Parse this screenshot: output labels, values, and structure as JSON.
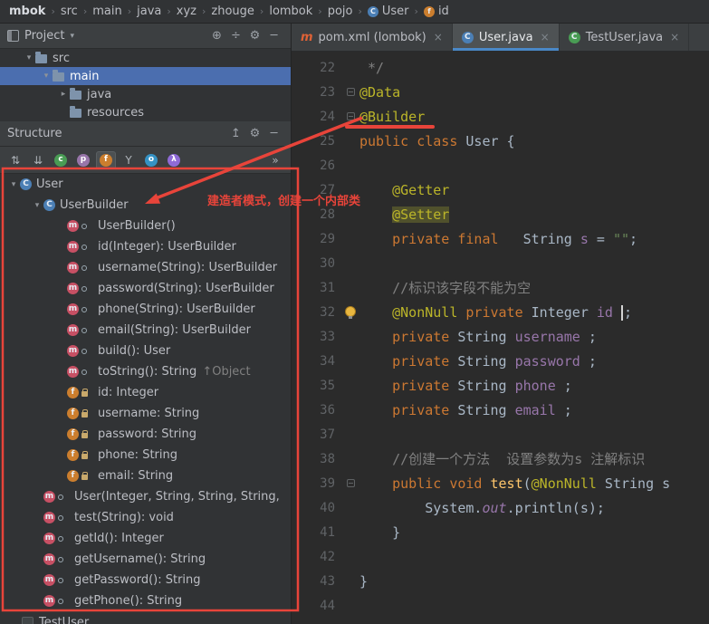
{
  "colors": {
    "annotation_red": "#e8443a",
    "active_tab_underline": "#4a88c7",
    "selection_blue": "#4b6eaf",
    "editor_background": "#2b2b2b"
  },
  "breadcrumbs": {
    "separator": "›",
    "items": [
      {
        "label": "mbok",
        "bold": true
      },
      {
        "label": "src"
      },
      {
        "label": "main"
      },
      {
        "label": "java"
      },
      {
        "label": "xyz"
      },
      {
        "label": "zhouge"
      },
      {
        "label": "lombok"
      },
      {
        "label": "pojo"
      },
      {
        "label": "User",
        "icon": "class"
      },
      {
        "label": "id",
        "icon": "field"
      }
    ]
  },
  "project": {
    "title": "Project",
    "header_icons": [
      {
        "name": "locate-button",
        "glyph": "⊕"
      },
      {
        "name": "collapse-all-button",
        "glyph": "÷"
      },
      {
        "name": "settings-button",
        "glyph": "⚙"
      },
      {
        "name": "hide-panel-button",
        "glyph": "─"
      }
    ],
    "rows": [
      {
        "label": "src",
        "level": 1,
        "chevron": "down"
      },
      {
        "label": "main",
        "level": 2,
        "chevron": "down",
        "selected": true
      },
      {
        "label": "java",
        "level": 3,
        "chevron": "right"
      },
      {
        "label": "resources",
        "level": 3,
        "chevron": "none"
      }
    ]
  },
  "structure": {
    "title": "Structure",
    "header_icons": [
      {
        "name": "scroll-to-source-button",
        "glyph": "↥"
      },
      {
        "name": "settings-button",
        "glyph": "⚙"
      },
      {
        "name": "hide-panel-button",
        "glyph": "─"
      }
    ],
    "toolbar": [
      {
        "name": "sort-alpha-button",
        "glyph": "⇅"
      },
      {
        "name": "sort-visibility-button",
        "glyph": "⇊"
      },
      {
        "name": "show-classes-toggle",
        "letter": "c",
        "color": "#499c54"
      },
      {
        "name": "show-properties-toggle",
        "letter": "p",
        "color": "#9876aa"
      },
      {
        "name": "show-fields-toggle",
        "letter": "f",
        "color": "#cb7e2e",
        "active": true
      },
      {
        "name": "filter-toggle",
        "glyph": "Y"
      },
      {
        "name": "show-objects-toggle",
        "letter": "o",
        "color": "#3592c4"
      },
      {
        "name": "show-lambdas-toggle",
        "letter": "λ",
        "color": "#8f6bd6"
      },
      {
        "name": "more-actions-button",
        "glyph": "»",
        "right": true
      }
    ],
    "rows": [
      {
        "label": "User",
        "icon": "class",
        "level": 0,
        "chevron": "down"
      },
      {
        "label": "UserBuilder",
        "icon": "class",
        "level": 1,
        "chevron": "down"
      },
      {
        "label": "UserBuilder()",
        "icon": "method",
        "emblem": "pub",
        "level": 2
      },
      {
        "label": "id(Integer): UserBuilder",
        "icon": "method",
        "emblem": "pub",
        "level": 2
      },
      {
        "label": "username(String): UserBuilder",
        "icon": "method",
        "emblem": "pub",
        "level": 2
      },
      {
        "label": "password(String): UserBuilder",
        "icon": "method",
        "emblem": "pub",
        "level": 2
      },
      {
        "label": "phone(String): UserBuilder",
        "icon": "method",
        "emblem": "pub",
        "level": 2
      },
      {
        "label": "email(String): UserBuilder",
        "icon": "method",
        "emblem": "pub",
        "level": 2
      },
      {
        "label": "build(): User",
        "icon": "method",
        "emblem": "pub",
        "level": 2
      },
      {
        "label": "toString(): String",
        "suffix": "↑Object",
        "icon": "method",
        "emblem": "pub",
        "level": 2
      },
      {
        "label": "id: Integer",
        "icon": "field",
        "emblem": "lock",
        "level": 2
      },
      {
        "label": "username: String",
        "icon": "field",
        "emblem": "lock",
        "level": 2
      },
      {
        "label": "password: String",
        "icon": "field",
        "emblem": "lock",
        "level": 2
      },
      {
        "label": "phone: String",
        "icon": "field",
        "emblem": "lock",
        "level": 2
      },
      {
        "label": "email: String",
        "icon": "field",
        "emblem": "lock",
        "level": 2
      },
      {
        "label": "User(Integer, String, String, String,",
        "icon": "method",
        "emblem": "pub",
        "level": 1
      },
      {
        "label": "test(String): void",
        "icon": "method",
        "emblem": "pub",
        "level": 1
      },
      {
        "label": "getId(): Integer",
        "icon": "method",
        "emblem": "pub",
        "level": 1
      },
      {
        "label": "getUsername(): String",
        "icon": "method",
        "emblem": "pub",
        "level": 1
      },
      {
        "label": "getPassword(): String",
        "icon": "method",
        "emblem": "pub",
        "level": 1
      },
      {
        "label": "getPhone(): String",
        "icon": "method",
        "emblem": "pub",
        "level": 1
      }
    ],
    "partial_bottom_label": "TestUser"
  },
  "editor": {
    "tabs": [
      {
        "label": "pom.xml (lombok)",
        "icon": "maven"
      },
      {
        "label": "User.java",
        "icon": "class",
        "active": true
      },
      {
        "label": "TestUser.java",
        "icon": "testclass"
      }
    ],
    "close_glyph": "×",
    "lines": [
      {
        "num": 22,
        "tokens": [
          [
            " */",
            "cmt"
          ]
        ]
      },
      {
        "num": 23,
        "fold": true,
        "tokens": [
          [
            "@Data",
            "ann"
          ]
        ]
      },
      {
        "num": 24,
        "fold": true,
        "tokens": [
          [
            "@Builder",
            "ann"
          ]
        ]
      },
      {
        "num": 25,
        "tokens": [
          [
            "public class",
            "kw"
          ],
          [
            " User {",
            "pln"
          ]
        ]
      },
      {
        "num": 26,
        "tokens": []
      },
      {
        "num": 27,
        "tokens": [
          [
            "    ",
            "pln"
          ],
          [
            "@Getter",
            "ann"
          ]
        ]
      },
      {
        "num": 28,
        "tokens": [
          [
            "    ",
            "pln"
          ],
          [
            "@Setter",
            "annhl"
          ]
        ]
      },
      {
        "num": 29,
        "tokens": [
          [
            "    ",
            "pln"
          ],
          [
            "private final",
            "kw"
          ],
          [
            "   String ",
            "pln"
          ],
          [
            "s",
            "fld"
          ],
          [
            " = ",
            "pln"
          ],
          [
            "\"\"",
            "str"
          ],
          [
            ";",
            "pln"
          ]
        ]
      },
      {
        "num": 30,
        "tokens": []
      },
      {
        "num": 31,
        "tokens": [
          [
            "    ",
            "pln"
          ],
          [
            "//标识该字段不能为空",
            "cmt"
          ]
        ]
      },
      {
        "num": 32,
        "bulb": true,
        "tokens": [
          [
            "    ",
            "pln"
          ],
          [
            "@NonNull",
            "ann"
          ],
          [
            " ",
            "pln"
          ],
          [
            "private",
            "kw"
          ],
          [
            " ",
            "pln"
          ],
          [
            "Integer ",
            "pln"
          ],
          [
            "id",
            "fld"
          ],
          [
            " ",
            "pln"
          ],
          [
            "",
            "caret"
          ],
          [
            ";",
            "pln"
          ]
        ]
      },
      {
        "num": 33,
        "tokens": [
          [
            "    ",
            "pln"
          ],
          [
            "private",
            "kw"
          ],
          [
            " String ",
            "pln"
          ],
          [
            "username",
            "fld"
          ],
          [
            " ;",
            "pln"
          ]
        ]
      },
      {
        "num": 34,
        "tokens": [
          [
            "    ",
            "pln"
          ],
          [
            "private",
            "kw"
          ],
          [
            " String ",
            "pln"
          ],
          [
            "password",
            "fld"
          ],
          [
            " ;",
            "pln"
          ]
        ]
      },
      {
        "num": 35,
        "tokens": [
          [
            "    ",
            "pln"
          ],
          [
            "private",
            "kw"
          ],
          [
            " String ",
            "pln"
          ],
          [
            "phone",
            "fld"
          ],
          [
            " ;",
            "pln"
          ]
        ]
      },
      {
        "num": 36,
        "tokens": [
          [
            "    ",
            "pln"
          ],
          [
            "private",
            "kw"
          ],
          [
            " String ",
            "pln"
          ],
          [
            "email",
            "fld"
          ],
          [
            " ;",
            "pln"
          ]
        ]
      },
      {
        "num": 37,
        "tokens": []
      },
      {
        "num": 38,
        "tokens": [
          [
            "    ",
            "pln"
          ],
          [
            "//创建一个方法  设置参数为s 注解标识",
            "cmt"
          ]
        ]
      },
      {
        "num": 39,
        "fold": true,
        "tokens": [
          [
            "    ",
            "pln"
          ],
          [
            "public void ",
            "kw"
          ],
          [
            "test",
            "mtd"
          ],
          [
            "(",
            "pln"
          ],
          [
            "@NonNull",
            "ann"
          ],
          [
            " String s",
            "pln"
          ]
        ]
      },
      {
        "num": 40,
        "tokens": [
          [
            "        System.",
            "pln"
          ],
          [
            "out",
            "static"
          ],
          [
            ".println(s);",
            "pln"
          ]
        ]
      },
      {
        "num": 41,
        "tokens": [
          [
            "    }",
            "pln"
          ]
        ]
      },
      {
        "num": 42,
        "tokens": []
      },
      {
        "num": 43,
        "tokens": [
          [
            "}",
            "pln"
          ]
        ]
      },
      {
        "num": 44,
        "tokens": []
      }
    ]
  },
  "overlay": {
    "note": "建造者模式，创建一个内部类"
  }
}
